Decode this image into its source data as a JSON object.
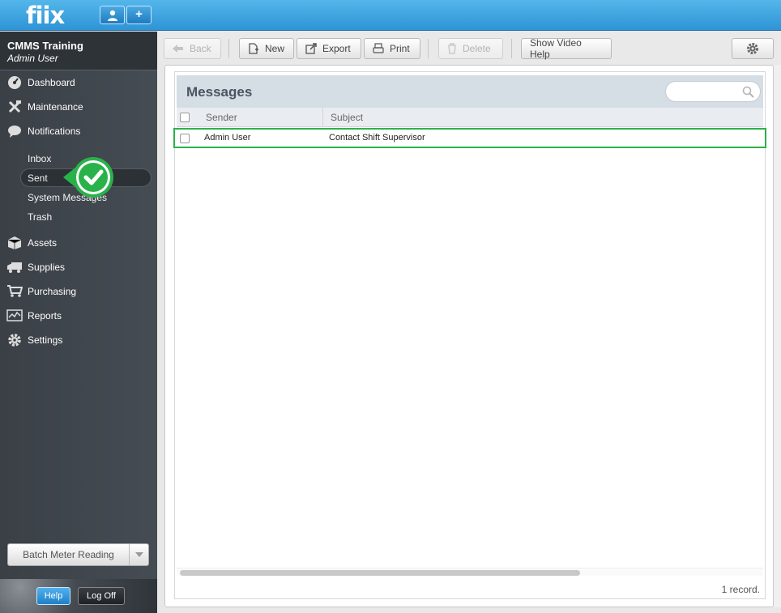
{
  "app": {
    "logo": "fiix"
  },
  "topbar": {
    "user_icon": "user-icon",
    "add_icon": "plus-icon",
    "add_label": "+"
  },
  "sidebar": {
    "org_name": "CMMS Training",
    "user_name": "Admin User",
    "nav": [
      {
        "label": "Dashboard",
        "icon": "dashboard-gauge-icon"
      },
      {
        "label": "Maintenance",
        "icon": "wrench-hammer-icon"
      },
      {
        "label": "Notifications",
        "icon": "speech-bubble-icon"
      },
      {
        "label": "Assets",
        "icon": "box-icon"
      },
      {
        "label": "Supplies",
        "icon": "truck-icon"
      },
      {
        "label": "Purchasing",
        "icon": "cart-icon"
      },
      {
        "label": "Reports",
        "icon": "chart-icon"
      },
      {
        "label": "Settings",
        "icon": "gear-icon"
      }
    ],
    "notifications_sub": [
      {
        "label": "Inbox"
      },
      {
        "label": "Sent",
        "selected": true
      },
      {
        "label": "System Messages"
      },
      {
        "label": "Trash"
      }
    ],
    "batch_button": "Batch Meter Reading",
    "help_button": "Help",
    "logoff_button": "Log Off"
  },
  "toolbar": {
    "back": "Back",
    "new": "New",
    "export": "Export",
    "print": "Print",
    "delete": "Delete",
    "video_help": "Show Video Help"
  },
  "messages": {
    "title": "Messages",
    "search_placeholder": "",
    "columns": {
      "sender": "Sender",
      "subject": "Subject"
    },
    "rows": [
      {
        "sender": "Admin User",
        "subject": "Contact Shift Supervisor"
      }
    ],
    "record_count": "1 record."
  },
  "colors": {
    "accent": "#2f94d6",
    "highlight": "#2ab24a",
    "sidebar": "#3f454b"
  }
}
